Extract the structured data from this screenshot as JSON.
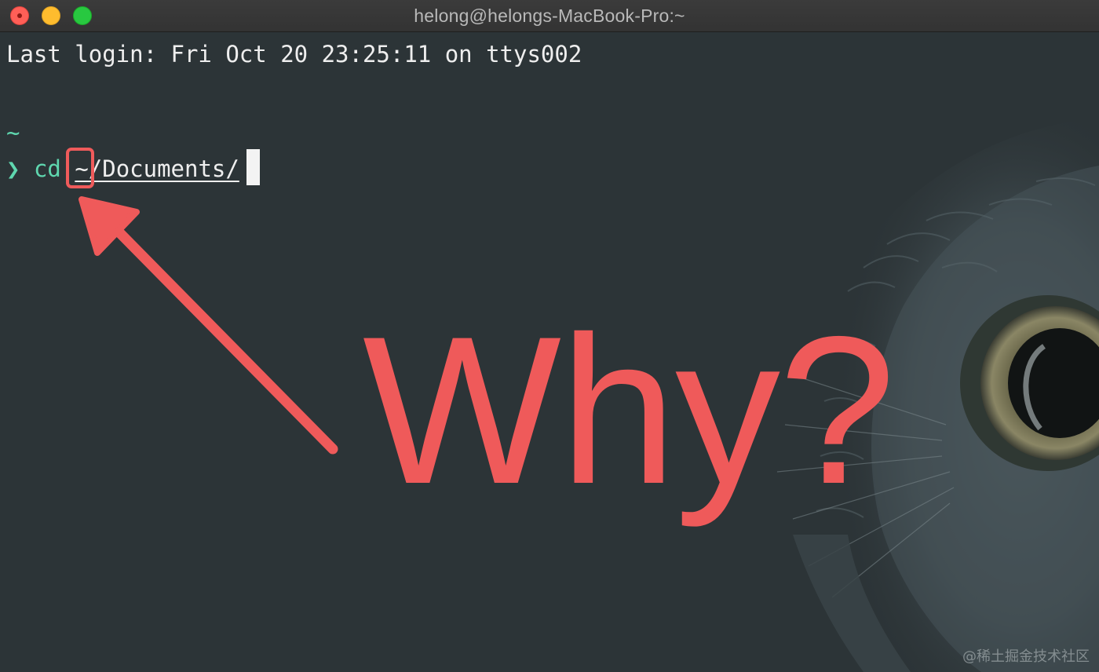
{
  "window": {
    "title": "helong@helongs-MacBook-Pro:~"
  },
  "terminal": {
    "last_login": "Last login: Fri Oct 20 23:25:11 on ttys002",
    "cwd_line": "~",
    "prompt_symbol": "❯",
    "command": "cd",
    "argument": "~/Documents/"
  },
  "annotation": {
    "text": "Why?",
    "color": "#ef5a5a"
  },
  "watermark": "@稀土掘金技术社区",
  "colors": {
    "background": "#2c3437",
    "prompt": "#5fd7af",
    "text": "#eeeeee"
  },
  "icons": {
    "close": "close-button",
    "minimize": "minimize-button",
    "zoom": "zoom-button",
    "owl": "owl-illustration"
  }
}
